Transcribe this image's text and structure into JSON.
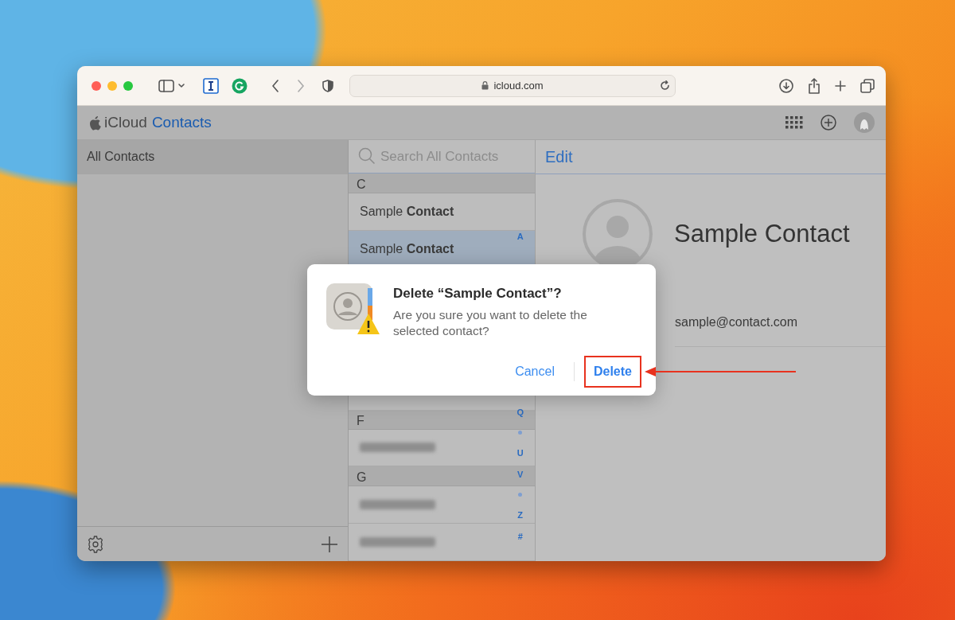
{
  "browser": {
    "address": "icloud.com"
  },
  "app": {
    "brand": "iCloud",
    "title": "Contacts"
  },
  "sidebar": {
    "groups": [
      {
        "label": "All Contacts",
        "selected": true
      }
    ]
  },
  "list": {
    "search": {
      "placeholder": "Search All Contacts"
    },
    "sections": [
      {
        "letter": "C",
        "rows": [
          {
            "kind": "name",
            "name": "Sample **Contact**",
            "selected": false
          },
          {
            "kind": "name",
            "name": "Sample **Contact**",
            "selected": true
          }
        ]
      },
      {
        "letter": "F",
        "rows": [
          {
            "kind": "blurred",
            "selected": false
          }
        ]
      },
      {
        "letter": "G",
        "rows": [
          {
            "kind": "blurred",
            "selected": false
          },
          {
            "kind": "blurred",
            "selected": false
          }
        ]
      }
    ],
    "index": [
      {
        "kind": "letter",
        "text": "A"
      },
      {
        "kind": "letter",
        "text": "Q"
      },
      {
        "kind": "dot"
      },
      {
        "kind": "letter",
        "text": "U"
      },
      {
        "kind": "letter",
        "text": "V"
      },
      {
        "kind": "dot"
      },
      {
        "kind": "letter",
        "text": "Z"
      },
      {
        "kind": "letter",
        "text": "#"
      }
    ]
  },
  "detail": {
    "edit": "Edit",
    "name": "Sample Contact",
    "email": "sample@contact.com"
  },
  "dialog": {
    "title": "Delete “Sample Contact”?",
    "message": "Are you sure you want to delete the selected contact?",
    "buttons": [
      {
        "label": "Cancel",
        "kind": "cancel"
      },
      {
        "label": "Delete",
        "kind": "primary",
        "highlighted": true
      }
    ]
  }
}
